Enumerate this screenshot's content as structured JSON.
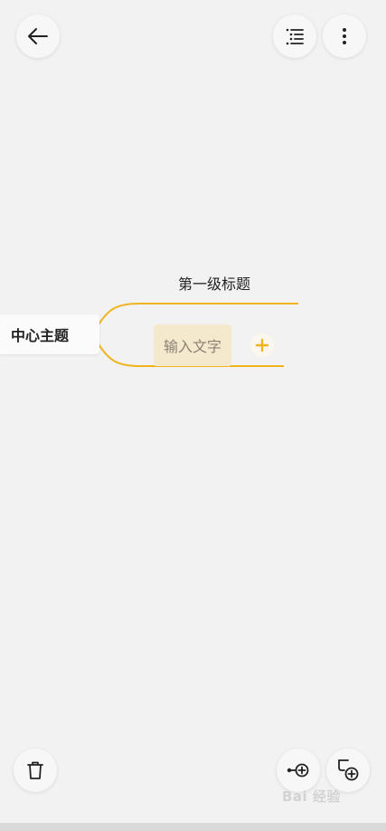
{
  "colors": {
    "background": "#f2f2f2",
    "branch": "#f0b41e",
    "input_highlight": "#f5e9cd"
  },
  "toolbar": {
    "back_icon": "arrow-left-icon",
    "outline_icon": "outline-list-icon",
    "more_icon": "more-vertical-icon"
  },
  "mindmap": {
    "central_topic": "中心主题",
    "branches": [
      {
        "label": "第一级标题"
      },
      {
        "placeholder": "输入文字"
      }
    ],
    "add_icon": "plus-icon"
  },
  "bottom_toolbar": {
    "delete_icon": "trash-icon",
    "add_sibling_icon": "add-sibling-node-icon",
    "add_child_icon": "add-child-node-icon"
  },
  "watermark": {
    "text": "Bai 经验"
  }
}
